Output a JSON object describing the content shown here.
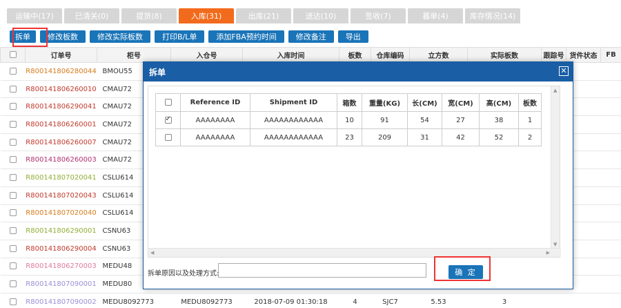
{
  "tabs": [
    {
      "label": "运输中(17)",
      "active": false
    },
    {
      "label": "已清关(0)",
      "active": false
    },
    {
      "label": "提货(8)",
      "active": false
    },
    {
      "label": "入库(31)",
      "active": true
    },
    {
      "label": "出库(21)",
      "active": false
    },
    {
      "label": "送达(10)",
      "active": false
    },
    {
      "label": "签收(7)",
      "active": false
    },
    {
      "label": "暮单(4)",
      "active": false
    },
    {
      "label": "库存情况(14)",
      "active": false
    }
  ],
  "toolbar": {
    "split": "拆单",
    "edit_pallets": "修改板数",
    "edit_actual_pallets": "修改实际板数",
    "print_bl": "打印B/L单",
    "add_fba_time": "添加FBA预约时间",
    "edit_note": "修改备注",
    "export": "导出"
  },
  "table": {
    "headers": [
      "订单号",
      "柜号",
      "入仓号",
      "入库时间",
      "板数",
      "仓库编码",
      "立方数",
      "实际板数",
      "跟踪号",
      "货件状态",
      "FB"
    ],
    "rows": [
      {
        "order": "R800141806280044",
        "color": "#d77b1c",
        "container": "BMOU55",
        "entry": "",
        "time": "",
        "pallets": "",
        "wh": "",
        "cbm": "",
        "actual": ""
      },
      {
        "order": "R800141806260010",
        "color": "#c0392b",
        "container": "CMAU72",
        "entry": "",
        "time": "",
        "pallets": "",
        "wh": "",
        "cbm": "",
        "actual": ""
      },
      {
        "order": "R800141806290041",
        "color": "#c0392b",
        "container": "CMAU72",
        "entry": "",
        "time": "",
        "pallets": "",
        "wh": "",
        "cbm": "",
        "actual": ""
      },
      {
        "order": "R800141806260001",
        "color": "#c0392b",
        "container": "CMAU72",
        "entry": "",
        "time": "",
        "pallets": "",
        "wh": "",
        "cbm": "",
        "actual": ""
      },
      {
        "order": "R800141806260007",
        "color": "#c0392b",
        "container": "CMAU72",
        "entry": "",
        "time": "",
        "pallets": "",
        "wh": "",
        "cbm": "",
        "actual": ""
      },
      {
        "order": "R800141806260003",
        "color": "#b0316e",
        "container": "CMAU72",
        "entry": "",
        "time": "",
        "pallets": "",
        "wh": "",
        "cbm": "",
        "actual": ""
      },
      {
        "order": "R800141807020041",
        "color": "#8fae35",
        "container": "CSLU614",
        "entry": "",
        "time": "",
        "pallets": "",
        "wh": "",
        "cbm": "",
        "actual": ""
      },
      {
        "order": "R800141807020043",
        "color": "#c0392b",
        "container": "CSLU614",
        "entry": "",
        "time": "",
        "pallets": "",
        "wh": "",
        "cbm": "",
        "actual": ""
      },
      {
        "order": "R800141807020040",
        "color": "#d77b1c",
        "container": "CSLU614",
        "entry": "",
        "time": "",
        "pallets": "",
        "wh": "",
        "cbm": "",
        "actual": ""
      },
      {
        "order": "R800141806290001",
        "color": "#8fae35",
        "container": "CSNU63",
        "entry": "",
        "time": "",
        "pallets": "",
        "wh": "",
        "cbm": "",
        "actual": ""
      },
      {
        "order": "R800141806290004",
        "color": "#c0392b",
        "container": "CSNU63",
        "entry": "",
        "time": "",
        "pallets": "",
        "wh": "",
        "cbm": "",
        "actual": ""
      },
      {
        "order": "R800141806270003",
        "color": "#e07a9a",
        "container": "MEDU48",
        "entry": "",
        "time": "",
        "pallets": "",
        "wh": "",
        "cbm": "",
        "actual": ""
      },
      {
        "order": "R800141807090001",
        "color": "#9a8fd6",
        "container": "MEDU80",
        "entry": "",
        "time": "",
        "pallets": "",
        "wh": "",
        "cbm": "",
        "actual": ""
      },
      {
        "order": "R800141807090002",
        "color": "#9a8fd6",
        "container": "MEDU8092773",
        "entry": "MEDU8092773",
        "time": "2018-07-09 01:30:18",
        "pallets": "4",
        "wh": "SJC7",
        "cbm": "5.53",
        "actual": "3"
      }
    ]
  },
  "modal": {
    "title": "拆单",
    "close_icon": "close-icon",
    "headers": [
      "",
      "Reference ID",
      "Shipment ID",
      "箱数",
      "重量(KG)",
      "长(CM)",
      "宽(CM)",
      "高(CM)",
      "板数"
    ],
    "rows": [
      {
        "checked": true,
        "ref": "AAAAAAAA",
        "shipment": "AAAAAAAAAAAA",
        "boxes": "10",
        "weight": "91",
        "length": "54",
        "width": "27",
        "height": "38",
        "pallets": "1"
      },
      {
        "checked": false,
        "ref": "AAAAAAAA",
        "shipment": "AAAAAAAAAAAA",
        "boxes": "23",
        "weight": "209",
        "length": "31",
        "width": "42",
        "height": "52",
        "pallets": "2"
      }
    ],
    "reason_label": "拆单原因以及处理方式:",
    "reason_value": "",
    "confirm": "确 定"
  },
  "accent": "#1a74b8",
  "active_tab_color": "#f26b1d"
}
